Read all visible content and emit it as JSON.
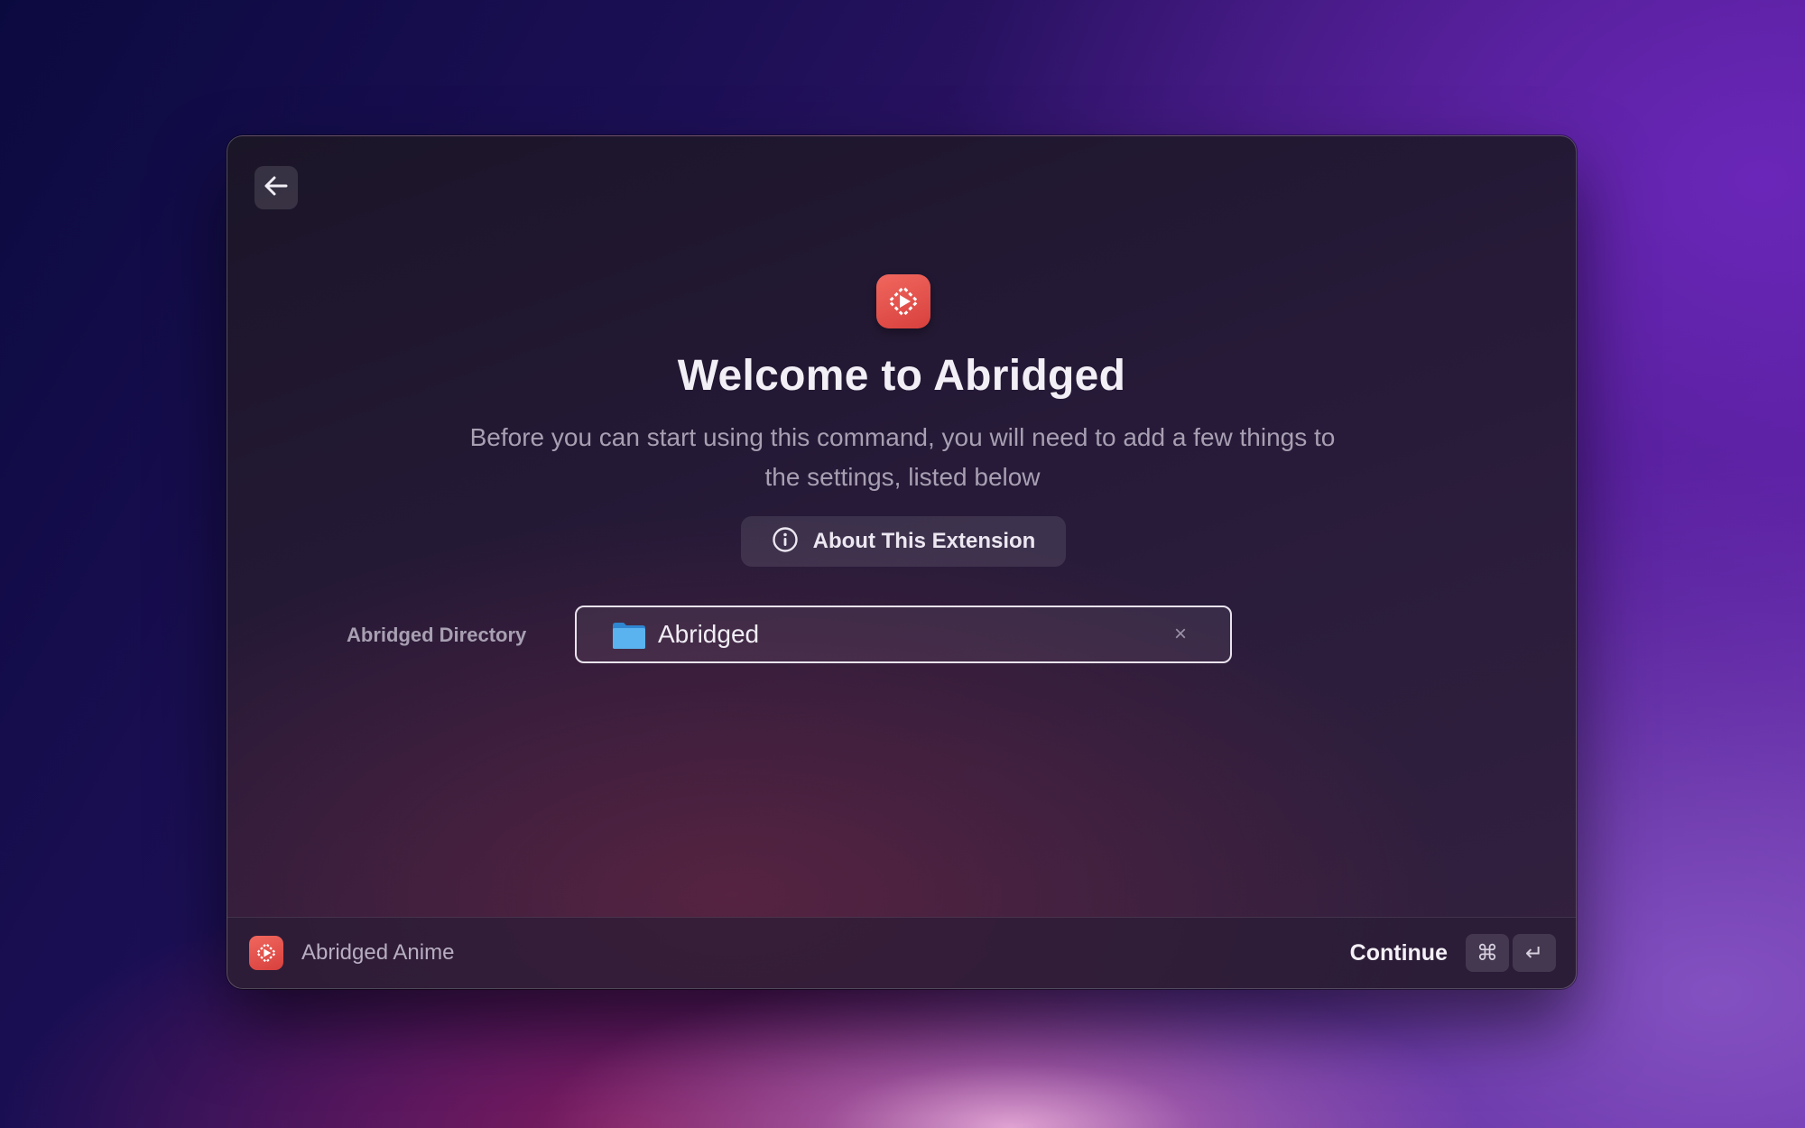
{
  "window": {
    "back_icon": "arrow-left-icon",
    "app_icon": "abridged-app-icon"
  },
  "welcome": {
    "title": "Welcome to Abridged",
    "subtitle": "Before you can start using this command, you will need to add a few things to the settings, listed below",
    "about_button_label": "About This Extension",
    "about_icon": "info-circle-icon"
  },
  "settings": {
    "directory_label": "Abridged Directory",
    "directory_value": "Abridged",
    "folder_icon": "folder-icon",
    "clear_glyph": "×"
  },
  "footer": {
    "extension_name": "Abridged Anime",
    "continue_label": "Continue",
    "shortcut_keys": [
      "⌘",
      "↵"
    ]
  },
  "colors": {
    "app_icon_red": "#e0504a",
    "folder_blue": "#4aa8ea"
  }
}
